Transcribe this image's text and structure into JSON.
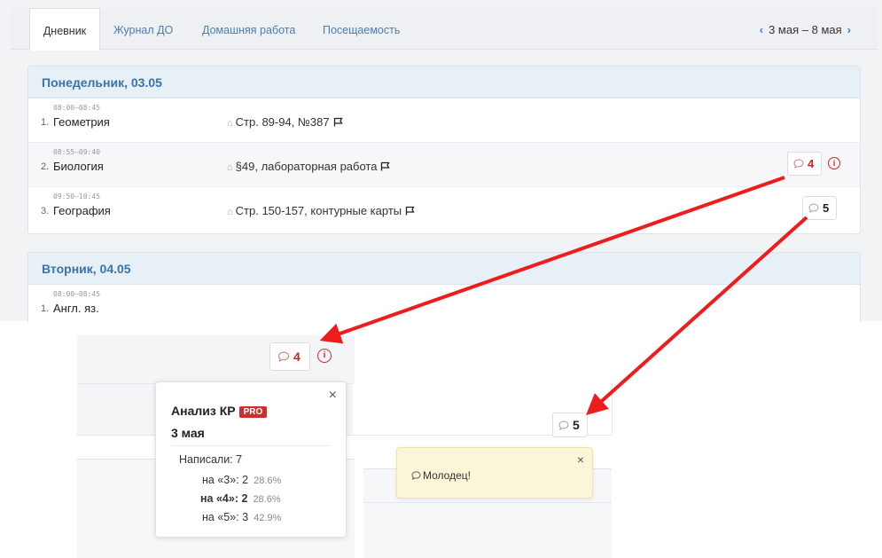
{
  "tabs": [
    {
      "label": "Дневник",
      "active": true
    },
    {
      "label": "Журнал ДО",
      "active": false
    },
    {
      "label": "Домашняя работа",
      "active": false
    },
    {
      "label": "Посещаемость",
      "active": false
    }
  ],
  "week_nav": {
    "prev": "‹",
    "range": "3 мая – 8 мая",
    "next": "›"
  },
  "days": [
    {
      "header": "Понедельник, 03.05",
      "lessons": [
        {
          "num": "1.",
          "time": "08:00–08:45",
          "subject": "Геометрия",
          "homework": "Стр. 89-94, №387"
        },
        {
          "num": "2.",
          "time": "08:55–09:40",
          "subject": "Биология",
          "homework": "§49, лабораторная работа",
          "comments": "4"
        },
        {
          "num": "3.",
          "time": "09:50–10:45",
          "subject": "География",
          "homework": "Стр. 150-157, контурные карты",
          "comments": "5"
        }
      ]
    },
    {
      "header": "Вторник, 04.05",
      "lessons": [
        {
          "num": "1.",
          "time": "08:00–08:45",
          "subject": "Англ. яз."
        }
      ]
    }
  ],
  "zoom_badge_red": "4",
  "zoom_badge_plain": "5",
  "popover": {
    "close": "×",
    "title": "Анализ КР",
    "pro": "PRO",
    "date": "3 мая",
    "wrote_label": "Написали:",
    "wrote_value": "7",
    "rows": [
      {
        "label": "на «3»:",
        "count": "2",
        "pct": "28.6%"
      },
      {
        "label": "на «4»:",
        "count": "2",
        "pct": "28.6%"
      },
      {
        "label": "на «5»:",
        "count": "3",
        "pct": "42.9%"
      }
    ]
  },
  "note": {
    "close": "×",
    "message": "Молодец!"
  },
  "colors": {
    "accent": "#3a72ad",
    "alert": "#c52a2a",
    "arrow": "#ee1c1c",
    "note_bg": "#fcf6d8"
  }
}
